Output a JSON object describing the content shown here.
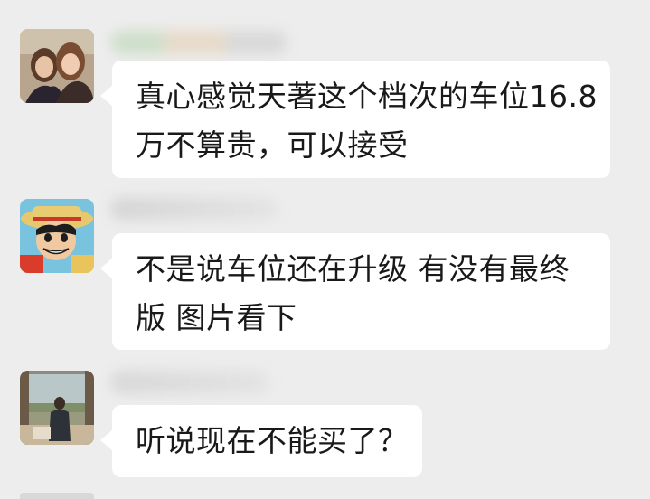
{
  "messages": [
    {
      "lines": [
        "真心感觉天著这个档次的车位16.8",
        "万不算贵，可以接受"
      ],
      "avatar_icon": "two-women-photo-avatar"
    },
    {
      "lines": [
        "不是说车位还在升级 有没有最终",
        "版 图片看下"
      ],
      "avatar_icon": "anime-pirate-avatar"
    },
    {
      "lines": [
        "听说现在不能买了？"
      ],
      "avatar_icon": "man-by-window-avatar"
    }
  ],
  "colors": {
    "background": "#ededed",
    "bubble": "#ffffff",
    "text": "#191919"
  }
}
